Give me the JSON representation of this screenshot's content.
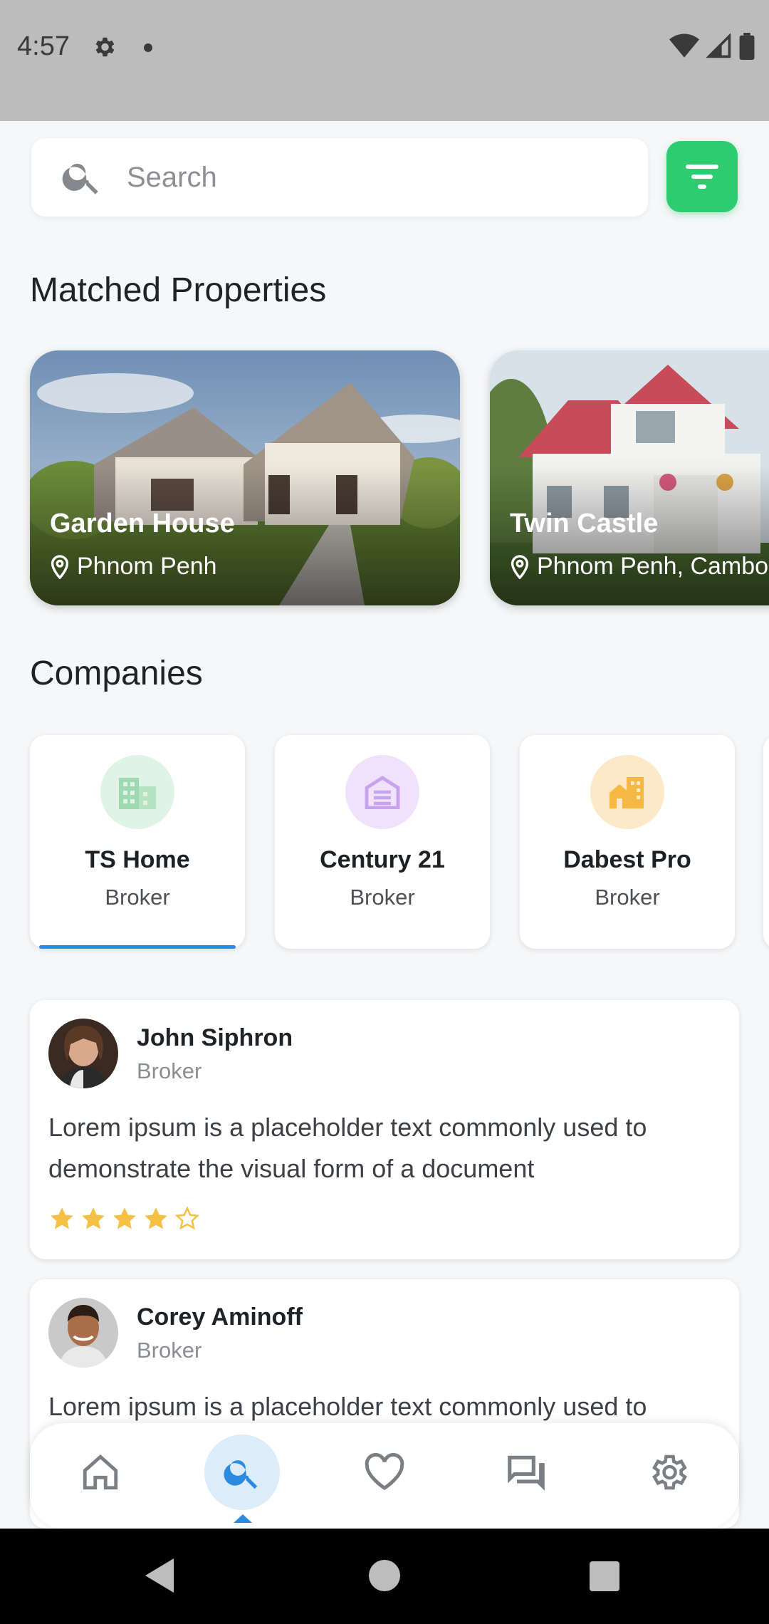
{
  "status_bar": {
    "time": "4:57"
  },
  "search": {
    "placeholder": "Search",
    "value": ""
  },
  "sections": {
    "matched_title": "Matched Properties",
    "companies_title": "Companies"
  },
  "properties": [
    {
      "name": "Garden House",
      "location": "Phnom Penh"
    },
    {
      "name": "Twin Castle",
      "location": "Phnom Penh, Cambodia"
    }
  ],
  "companies": [
    {
      "name": "TS Home",
      "type": "Broker",
      "icon": "building-icon",
      "color": "#dff3e6",
      "icon_color": "#9fd9b2",
      "selected": true
    },
    {
      "name": "Century 21",
      "type": "Broker",
      "icon": "garage-icon",
      "color": "#efe2fa",
      "icon_color": "#c8a2ec"
    },
    {
      "name": "Dabest Pro",
      "type": "Broker",
      "icon": "house-building-icon",
      "color": "#fde9c7",
      "icon_color": "#f7b843"
    }
  ],
  "reviews": [
    {
      "name": "John Siphron",
      "role": "Broker",
      "text": "Lorem ipsum is a placeholder text commonly used to demonstrate the visual form of a document",
      "rating": 4,
      "max_rating": 5
    },
    {
      "name": "Corey Aminoff",
      "role": "Broker",
      "text": "Lorem ipsum is a placeholder text commonly used to demonstrate the visual form of a document"
    }
  ],
  "bottom_nav": {
    "items": [
      "home-icon",
      "search-icon",
      "heart-icon",
      "chat-icon",
      "settings-icon"
    ],
    "active": "search-icon"
  },
  "colors": {
    "accent_green": "#2ecc71",
    "accent_blue": "#2a8be0",
    "star": "#f6c044"
  }
}
